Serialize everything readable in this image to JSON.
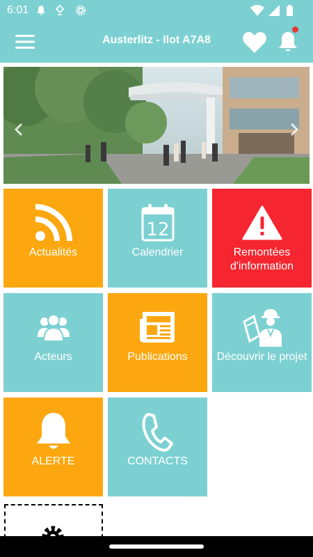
{
  "status_bar": {
    "time": "6:01",
    "icons": [
      "notification-bell-icon",
      "location-icon",
      "settings-gear-icon"
    ],
    "right_icons": [
      "wifi-icon",
      "signal-icon",
      "battery-icon"
    ]
  },
  "app_bar": {
    "title": "Austerlitz - Ilot A7A8",
    "icons": [
      "menu-icon",
      "heart-icon",
      "bell-icon"
    ],
    "notification_dot": true
  },
  "banner": {
    "prev_icon": "chevron-left-icon",
    "next_icon": "chevron-right-icon"
  },
  "tiles": [
    {
      "label": "Actualités",
      "icon": "rss-icon",
      "color": "#fca70f"
    },
    {
      "label": "Calendrier",
      "icon": "calendar-icon",
      "calendar_day": "12",
      "color": "#7dd0d2"
    },
    {
      "label": "Remontées d'information",
      "icon": "warning-icon",
      "color": "#f5262f"
    },
    {
      "label": "Acteurs",
      "icon": "people-icon",
      "color": "#7dd0d2"
    },
    {
      "label": "Publications",
      "icon": "newspaper-icon",
      "color": "#fca70f"
    },
    {
      "label": "Découvrir le projet",
      "icon": "engineer-icon",
      "color": "#7dd0d2"
    },
    {
      "label": "ALERTE",
      "icon": "bell-icon",
      "color": "#fca70f"
    },
    {
      "label": "CONTACTS",
      "icon": "phone-icon",
      "color": "#7dd0d2"
    }
  ],
  "extra_tile_icon": "gear-icon",
  "colors": {
    "primary": "#7dd0d2",
    "accent": "#fca70f",
    "alert": "#f5262f"
  }
}
